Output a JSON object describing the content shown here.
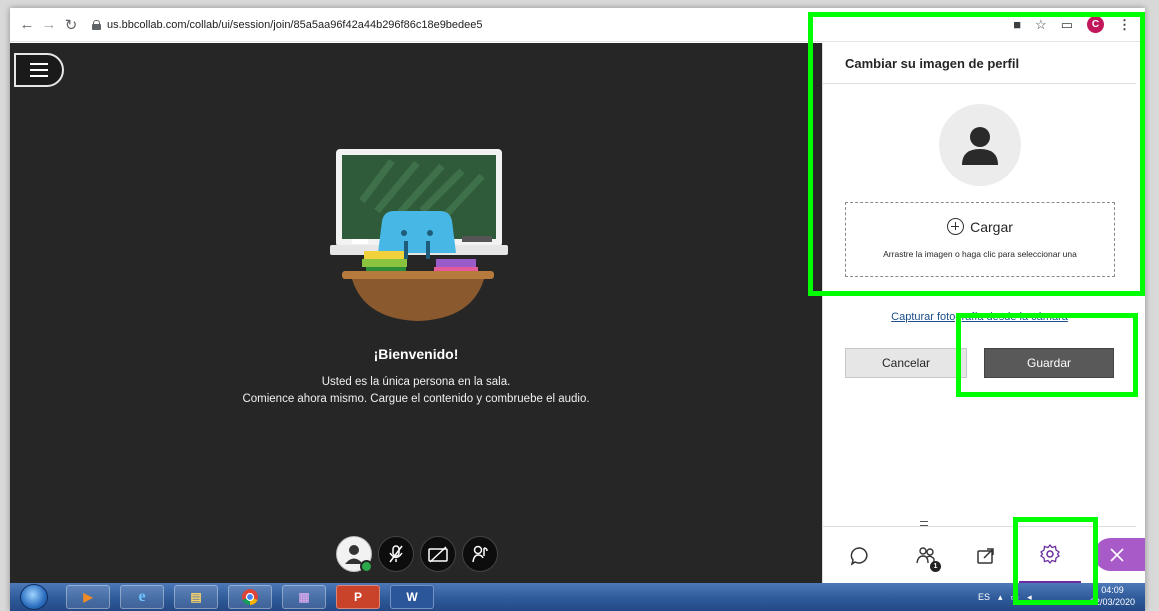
{
  "browser": {
    "url": "us.bbcollab.com/collab/ui/session/join/85a5aa96f42a44b296f86c18e9bedee5",
    "profile_initial": "C"
  },
  "stage": {
    "welcome_title": "¡Bienvenido!",
    "welcome_line1": "Usted es la única persona en la sala.",
    "welcome_line2": "Comience ahora mismo. Cargue el contenido y combruebe el audio."
  },
  "panel": {
    "title": "Cambiar su imagen de perfil",
    "upload_label": "Cargar",
    "upload_hint": "Arrastre la imagen o haga clic para seleccionar una",
    "camera_link": "Capturar fotografía desde la cámara",
    "cancel_label": "Cancelar",
    "save_label": "Guardar",
    "tabs": [
      {
        "icon": "chat-icon"
      },
      {
        "icon": "attendees-icon",
        "badge": "1"
      },
      {
        "icon": "share-content-icon"
      },
      {
        "icon": "settings-icon",
        "active": true
      }
    ]
  },
  "taskbar": {
    "language": "ES",
    "time": "04:09",
    "date": "02/03/2020",
    "apps": [
      "media-player-icon",
      "internet-explorer-icon",
      "file-explorer-icon",
      "chrome-icon",
      "winrar-icon",
      "powerpoint-icon",
      "word-icon"
    ]
  },
  "colors": {
    "highlight": "#00ff00",
    "stage_bg": "#262626",
    "accent_purple": "#6a2ea0",
    "save_button": "#595959"
  }
}
